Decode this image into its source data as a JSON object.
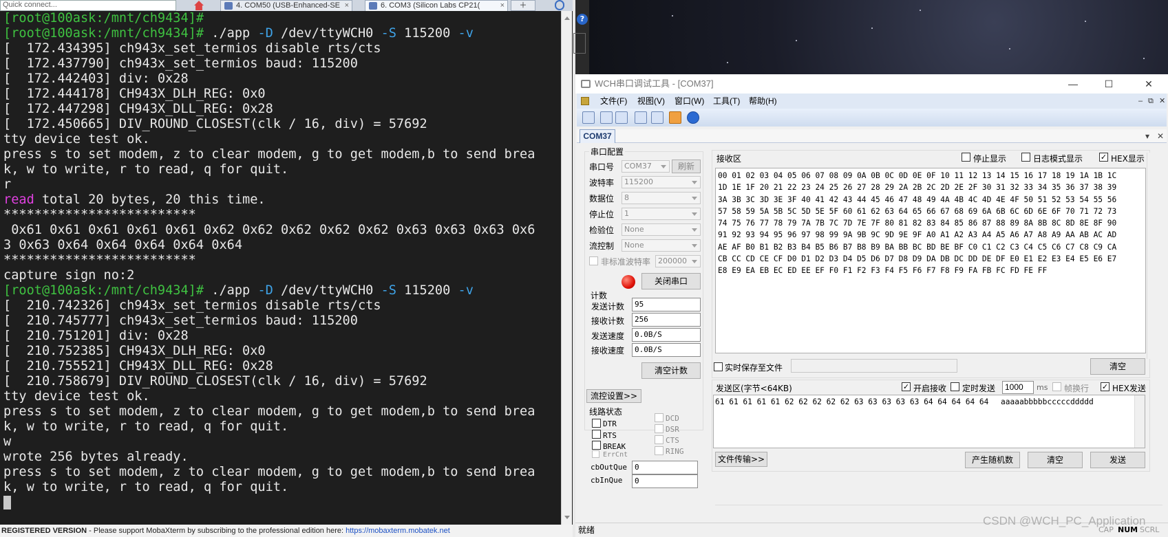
{
  "topbar": {
    "quick_connect_placeholder": "Quick connect...",
    "tabs": [
      {
        "label": "4. COM50  (USB-Enhanced-SE"
      },
      {
        "label": "6. COM3  (Silicon Labs CP21("
      }
    ],
    "tab_close": "×"
  },
  "terminal": {
    "lines": [
      [
        {
          "t": "[root@100ask:/mnt/ch9434]#",
          "c": "prompt"
        }
      ],
      [
        {
          "t": "[root@100ask:/mnt/ch9434]#",
          "c": "prompt"
        },
        {
          "t": " ./app "
        },
        {
          "t": "-D",
          "c": "flag"
        },
        {
          "t": " /dev/ttyWCH0 "
        },
        {
          "t": "-S",
          "c": "flag"
        },
        {
          "t": " 115200 "
        },
        {
          "t": "-v",
          "c": "flag"
        }
      ],
      [
        {
          "t": "[  172.434395] ch943x_set_termios disable rts/cts"
        }
      ],
      [
        {
          "t": "[  172.437790] ch943x_set_termios baud: 115200"
        }
      ],
      [
        {
          "t": "[  172.442403] div: 0x28"
        }
      ],
      [
        {
          "t": "[  172.444178] CH943X_DLH_REG: 0x0"
        }
      ],
      [
        {
          "t": "[  172.447298] CH943X_DLL_REG: 0x28"
        }
      ],
      [
        {
          "t": "[  172.450665] DIV_ROUND_CLOSEST(clk / 16, div) = 57692"
        }
      ],
      [
        {
          "t": "tty device test ok."
        }
      ],
      [
        {
          "t": "press s to set modem, z to clear modem, g to get modem,b to send brea"
        }
      ],
      [
        {
          "t": "k, w to write, r to read, q for quit."
        }
      ],
      [
        {
          "t": "r"
        }
      ],
      [
        {
          "t": "read",
          "c": "hl"
        },
        {
          "t": " total 20 bytes, 20 this time."
        }
      ],
      [
        {
          "t": "*************************"
        }
      ],
      [
        {
          "t": " 0x61 0x61 0x61 0x61 0x61 0x62 0x62 0x62 0x62 0x62 0x63 0x63 0x63 0x6"
        }
      ],
      [
        {
          "t": "3 0x63 0x64 0x64 0x64 0x64 0x64"
        }
      ],
      [
        {
          "t": "*************************"
        }
      ],
      [
        {
          "t": "capture sign no:2"
        }
      ],
      [
        {
          "t": "[root@100ask:/mnt/ch9434]#",
          "c": "prompt"
        },
        {
          "t": " ./app "
        },
        {
          "t": "-D",
          "c": "flag"
        },
        {
          "t": " /dev/ttyWCH0 "
        },
        {
          "t": "-S",
          "c": "flag"
        },
        {
          "t": " 115200 "
        },
        {
          "t": "-v",
          "c": "flag"
        }
      ],
      [
        {
          "t": "[  210.742326] ch943x_set_termios disable rts/cts"
        }
      ],
      [
        {
          "t": "[  210.745777] ch943x_set_termios baud: 115200"
        }
      ],
      [
        {
          "t": "[  210.751201] div: 0x28"
        }
      ],
      [
        {
          "t": "[  210.752385] CH943X_DLH_REG: 0x0"
        }
      ],
      [
        {
          "t": "[  210.755521] CH943X_DLL_REG: 0x28"
        }
      ],
      [
        {
          "t": "[  210.758679] DIV_ROUND_CLOSEST(clk / 16, div) = 57692"
        }
      ],
      [
        {
          "t": "tty device test ok."
        }
      ],
      [
        {
          "t": "press s to set modem, z to clear modem, g to get modem,b to send brea"
        }
      ],
      [
        {
          "t": "k, w to write, r to read, q for quit."
        }
      ],
      [
        {
          "t": "w"
        }
      ],
      [
        {
          "t": "wrote 256 bytes already."
        }
      ],
      [
        {
          "t": "press s to set modem, z to clear modem, g to get modem,b to send brea"
        }
      ],
      [
        {
          "t": "k, w to write, r to read, q for quit."
        }
      ]
    ],
    "colors": {
      "prompt": "#3fc241",
      "flag": "#3fa3e8",
      "highlight": "#e040e0"
    }
  },
  "mobaxterm_status": {
    "registered": "REGISTERED VERSION",
    "message": " -  Please support MobaXterm by subscribing to the professional edition here: ",
    "url": "https://mobaxterm.mobatek.net"
  },
  "wch": {
    "title": "WCH串口调试工具 - [COM37]",
    "window_controls": {
      "minimize": "—",
      "maximize": "☐",
      "close": "✕"
    },
    "menu": [
      {
        "label": "文件(F)"
      },
      {
        "label": "视图(V)"
      },
      {
        "label": "窗口(W)"
      },
      {
        "label": "工具(T)"
      },
      {
        "label": "帮助(H)"
      }
    ],
    "mdi_controls": {
      "minimize": "–",
      "restore": "⧉",
      "close": "✕"
    },
    "tab": "COM37",
    "tab_controls": {
      "dropdown": "▾",
      "close": "✕"
    },
    "serial_config": {
      "group_label": "串口配置",
      "fields": [
        {
          "label": "串口号",
          "value": "COM37"
        },
        {
          "label": "波特率",
          "value": "115200"
        },
        {
          "label": "数据位",
          "value": "8"
        },
        {
          "label": "停止位",
          "value": "1"
        },
        {
          "label": "检验位",
          "value": "None"
        },
        {
          "label": "流控制",
          "value": "None"
        }
      ],
      "refresh_button": "刷新",
      "nonstd_baud_label": "非标准波特率",
      "nonstd_baud_value": "200000",
      "close_port_button": "关闭串口"
    },
    "counts": {
      "group_label": "计数",
      "rows": [
        {
          "label": "发送计数",
          "value": "95"
        },
        {
          "label": "接收计数",
          "value": "256"
        },
        {
          "label": "发送速度",
          "value": "0.0B/S"
        },
        {
          "label": "接收速度",
          "value": "0.0B/S"
        }
      ],
      "clear_button": "清空计数"
    },
    "flow_settings_button": "流控设置>>",
    "line_status": {
      "group_label": "线路状态",
      "left": [
        "DTR",
        "RTS",
        "BREAK",
        "ErrCnt"
      ],
      "right": [
        "DCD",
        "DSR",
        "CTS",
        "RING"
      ],
      "cbOutQue_label": "cbOutQue",
      "cbOutQue_value": "0",
      "cbInQue_label": "cbInQue",
      "cbInQue_value": "0"
    },
    "receive": {
      "label": "接收区",
      "stop_display": "停止显示",
      "log_mode": "日志模式显示",
      "hex_display": "HEX显示",
      "hex_display_checked": true,
      "lines": [
        "00 01 02 03 04 05 06 07 08 09 0A 0B 0C 0D 0E 0F 10 11 12 13 14 15 16 17 18 19 1A 1B 1C",
        "1D 1E 1F 20 21 22 23 24 25 26 27 28 29 2A 2B 2C 2D 2E 2F 30 31 32 33 34 35 36 37 38 39",
        "3A 3B 3C 3D 3E 3F 40 41 42 43 44 45 46 47 48 49 4A 4B 4C 4D 4E 4F 50 51 52 53 54 55 56",
        "57 58 59 5A 5B 5C 5D 5E 5F 60 61 62 63 64 65 66 67 68 69 6A 6B 6C 6D 6E 6F 70 71 72 73",
        "74 75 76 77 78 79 7A 7B 7C 7D 7E 7F 80 81 82 83 84 85 86 87 88 89 8A 8B 8C 8D 8E 8F 90",
        "91 92 93 94 95 96 97 98 99 9A 9B 9C 9D 9E 9F A0 A1 A2 A3 A4 A5 A6 A7 A8 A9 AA AB AC AD",
        "AE AF B0 B1 B2 B3 B4 B5 B6 B7 B8 B9 BA BB BC BD BE BF C0 C1 C2 C3 C4 C5 C6 C7 C8 C9 CA",
        "CB CC CD CE CF D0 D1 D2 D3 D4 D5 D6 D7 D8 D9 DA DB DC DD DE DF E0 E1 E2 E3 E4 E5 E6 E7",
        "E8 E9 EA EB EC ED EE EF F0 F1 F2 F3 F4 F5 F6 F7 F8 F9 FA FB FC FD FE FF"
      ],
      "save_to_file": "实时保存至文件",
      "clear_button": "清空"
    },
    "send": {
      "label": "发送区(字节<64KB)",
      "enable_receive": "开启接收",
      "enable_receive_checked": true,
      "timed_send": "定时发送",
      "interval_value": "1000",
      "interval_unit": "ms",
      "frame_newline": "帧换行",
      "hex_send": "HEX发送",
      "hex_send_checked": true,
      "hex_content": "61 61 61 61 61 62 62 62 62 62 63 63 63 63 63 64 64 64 64 64",
      "ascii_content": "aaaaabbbbbcccccddddd",
      "file_transfer_button": "文件传输>>",
      "random_button": "产生随机数",
      "clear_button": "清空",
      "send_button": "发送"
    },
    "statusbar": {
      "ready": "就绪",
      "cap": "CAP",
      "num": "NUM",
      "scrl": "SCRL"
    },
    "watermark": "CSDN @WCH_PC_Application"
  }
}
